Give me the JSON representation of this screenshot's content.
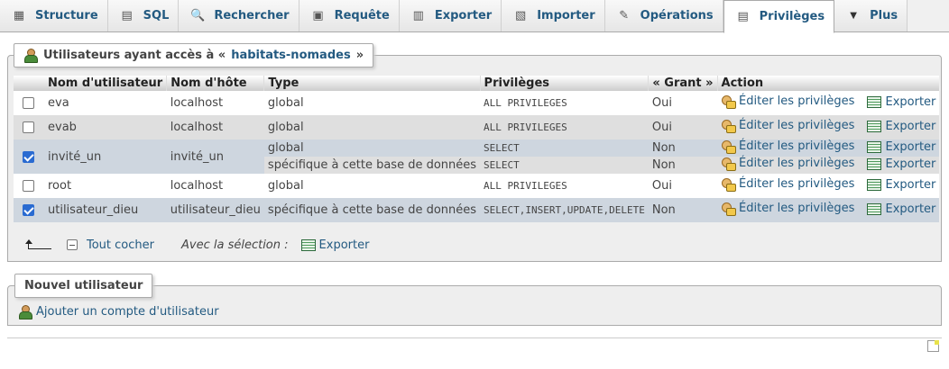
{
  "tabs": [
    {
      "label": "Structure",
      "icon": "structure-icon",
      "glyph": "▦"
    },
    {
      "label": "SQL",
      "icon": "sql-icon",
      "glyph": "▤"
    },
    {
      "label": "Rechercher",
      "icon": "search-icon",
      "glyph": "🔍"
    },
    {
      "label": "Requête",
      "icon": "query-icon",
      "glyph": "▣"
    },
    {
      "label": "Exporter",
      "icon": "export-icon",
      "glyph": "▥"
    },
    {
      "label": "Importer",
      "icon": "import-icon",
      "glyph": "▧"
    },
    {
      "label": "Opérations",
      "icon": "wrench-icon",
      "glyph": "✎"
    },
    {
      "label": "Privilèges",
      "icon": "privileges-icon",
      "glyph": "▤",
      "active": true
    },
    {
      "label": "Plus",
      "icon": "chevron-down-icon",
      "glyph": "▼"
    }
  ],
  "users_panel": {
    "legend_prefix": "Utilisateurs ayant accès à «",
    "database": "habitats-nomades",
    "legend_suffix": "»"
  },
  "table": {
    "headers": [
      "Nom d'utilisateur",
      "Nom d'hôte",
      "Type",
      "Privilèges",
      "« Grant »",
      "Action"
    ],
    "edit_label": "Éditer les privilèges",
    "export_label": "Exporter",
    "rows": [
      {
        "user": "eva",
        "host": "localhost",
        "checked": false,
        "grants": [
          {
            "type": "global",
            "privileges": "ALL PRIVILEGES",
            "grant": "Oui"
          }
        ]
      },
      {
        "user": "evab",
        "host": "localhost",
        "checked": false,
        "grants": [
          {
            "type": "global",
            "privileges": "ALL PRIVILEGES",
            "grant": "Oui"
          }
        ]
      },
      {
        "user": "invité_un",
        "host": "invité_un",
        "checked": true,
        "grants": [
          {
            "type": "global",
            "privileges": "SELECT",
            "grant": "Non"
          },
          {
            "type": "spécifique à cette base de données",
            "privileges": "SELECT",
            "grant": "Non"
          }
        ]
      },
      {
        "user": "root",
        "host": "localhost",
        "checked": false,
        "grants": [
          {
            "type": "global",
            "privileges": "ALL PRIVILEGES",
            "grant": "Oui"
          }
        ]
      },
      {
        "user": "utilisateur_dieu",
        "host": "utilisateur_dieu",
        "checked": true,
        "grants": [
          {
            "type": "spécifique à cette base de données",
            "privileges": "SELECT,INSERT,UPDATE,DELETE",
            "grant": "Non"
          }
        ]
      }
    ]
  },
  "bulk": {
    "check_all": "Tout cocher",
    "with_selection": "Avec la sélection :",
    "export": "Exporter"
  },
  "new_user_panel": {
    "legend": "Nouvel utilisateur",
    "add_link": "Ajouter un compte d'utilisateur"
  }
}
